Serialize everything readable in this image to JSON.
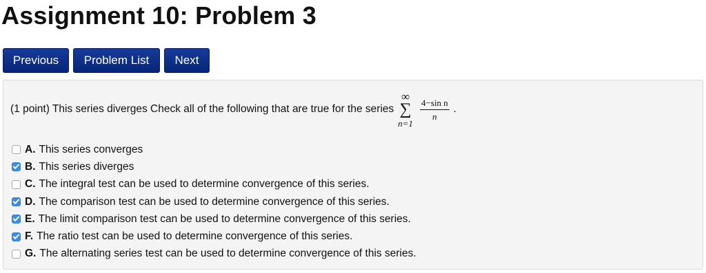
{
  "page": {
    "title": "Assignment 10: Problem 3"
  },
  "nav": {
    "previous_label": "Previous",
    "problem_list_label": "Problem List",
    "next_label": "Next"
  },
  "colors": {
    "button_bg": "#0a2e86",
    "checkbox_checked": "#3b8ee8",
    "panel_bg": "#f4f4f4"
  },
  "problem": {
    "question_text": "(1 point) This series diverges Check all of the following that are true for the series",
    "series": {
      "upper_limit": "∞",
      "sigma": "∑",
      "lower_limit": "n=1",
      "numerator": "4−sin n",
      "denominator": "n",
      "trailing": "."
    },
    "options": [
      {
        "letter": "A.",
        "text": "This series converges",
        "checked": false
      },
      {
        "letter": "B.",
        "text": "This series diverges",
        "checked": true
      },
      {
        "letter": "C.",
        "text": "The integral test can be used to determine convergence of this series.",
        "checked": false
      },
      {
        "letter": "D.",
        "text": "The comparison test can be used to determine convergence of this series.",
        "checked": true
      },
      {
        "letter": "E.",
        "text": "The limit comparison test can be used to determine convergence of this series.",
        "checked": true
      },
      {
        "letter": "F.",
        "text": "The ratio test can be used to determine convergence of this series.",
        "checked": true
      },
      {
        "letter": "G.",
        "text": "The alternating series test can be used to determine convergence of this series.",
        "checked": false
      }
    ]
  }
}
